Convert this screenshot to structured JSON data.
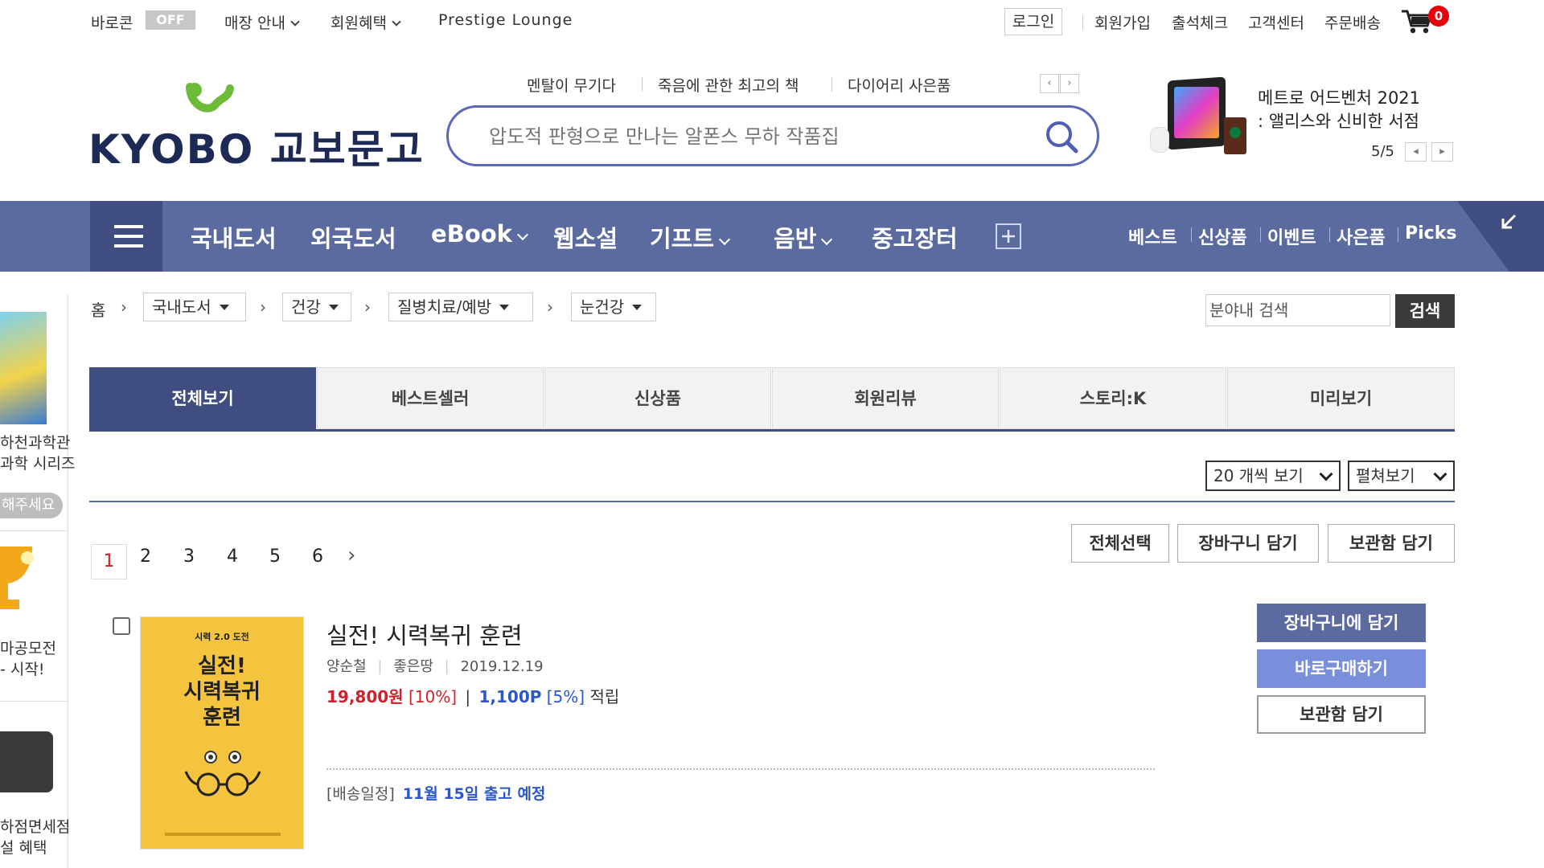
{
  "topbar": {
    "barocon_label": "바로콘",
    "barocon_state": "OFF",
    "store_info": "매장 안내",
    "member_benefits": "회원혜택",
    "prestige": "Prestige Lounge",
    "login": "로그인",
    "signup": "회원가입",
    "attendance": "출석체크",
    "customer_center": "고객센터",
    "order_delivery": "주문배송",
    "cart_count": "0"
  },
  "header": {
    "logo_text": "KYOBO 교보문고",
    "keywords": [
      "멘탈이 무기다",
      "죽음에 관한 최고의 책",
      "다이어리 사은품"
    ],
    "search_placeholder": "압도적 판형으로 만나는 알폰스 무하 작품집",
    "banner_line1": "메트로 어드벤처 2021",
    "banner_line2": ": 앨리스와 신비한 서점",
    "banner_page": "5/5"
  },
  "nav": {
    "items": [
      "국내도서",
      "외국도서",
      "eBook",
      "웹소설",
      "기프트",
      "음반",
      "중고장터"
    ],
    "right_links": [
      "베스트",
      "신상품",
      "이벤트",
      "사은품",
      "Picks"
    ]
  },
  "left_rail": {
    "promo1": [
      "하천과학관",
      "과학 시리즈"
    ],
    "promo1_btn": "해주세요",
    "promo2": [
      "마공모전",
      "- 시작!"
    ],
    "promo3": [
      "하점면세점",
      "설 혜택"
    ]
  },
  "breadcrumb": {
    "home": "홈",
    "levels": [
      "국내도서",
      "건강",
      "질병치료/예방",
      "눈건강"
    ]
  },
  "category_search": {
    "placeholder": "분야내 검색",
    "button": "검색"
  },
  "tabs": [
    "전체보기",
    "베스트셀러",
    "신상품",
    "회원리뷰",
    "스토리:K",
    "미리보기"
  ],
  "view_options": {
    "per_page": "20 개씩 보기",
    "mode": "펼쳐보기"
  },
  "pager": {
    "current": "1",
    "pages": [
      "2",
      "3",
      "4",
      "5",
      "6"
    ],
    "next": "›"
  },
  "list_actions": [
    "전체선택",
    "장바구니 담기",
    "보관함 담기"
  ],
  "product": {
    "title": "실전! 시력복귀 훈련",
    "author": "양순철",
    "publisher": "좋은땅",
    "date": "2019.12.19",
    "price": "19,800원",
    "discount": "[10%]",
    "points": "1,100P",
    "points_rate": "[5%]",
    "points_suffix": "적립",
    "ship_label": "[배송일정]",
    "ship_date": "11월 15일 출고 예정",
    "cover_series": "시력 2.0 도전",
    "cover_title1": "실전!",
    "cover_title2": "시력복귀",
    "cover_title3": "훈련",
    "buttons": {
      "cart": "장바구니에 담기",
      "buy_now": "바로구매하기",
      "wishlist": "보관함 담기"
    }
  },
  "colors": {
    "nav_bg": "#5c6b9f",
    "nav_dark": "#3f4d80",
    "accent_red": "#d21f2a",
    "accent_blue": "#2b57c9",
    "search_border": "#5a68b8",
    "cover_yellow": "#f5c43f"
  }
}
